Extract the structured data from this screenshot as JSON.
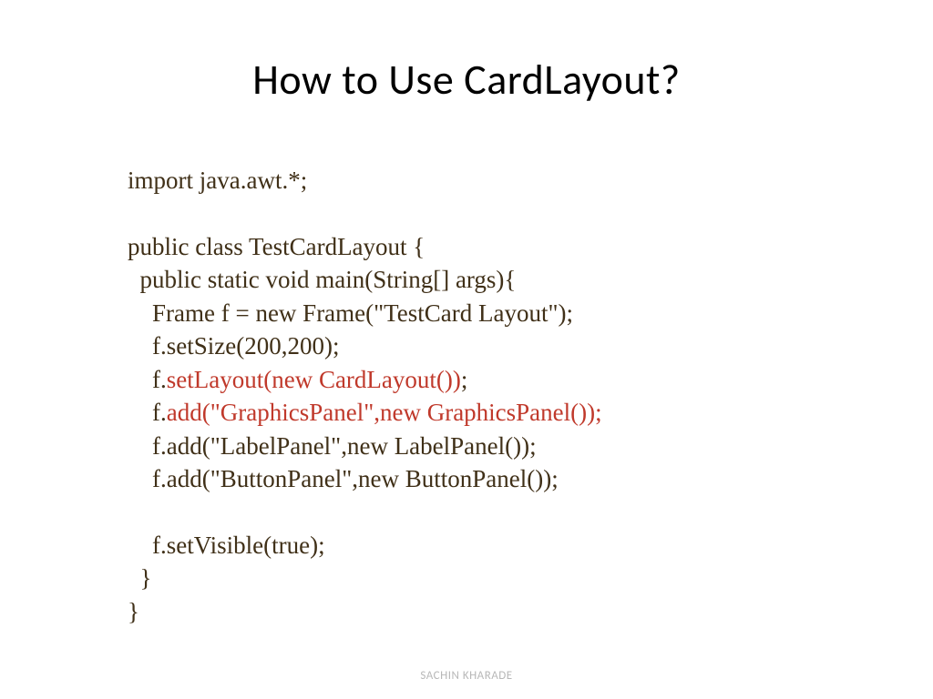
{
  "title": "How to Use CardLayout?",
  "code": {
    "line1": "import java.awt.*;",
    "line2": "",
    "line3": "public class TestCardLayout {",
    "line4": "  public static void main(String[] args){",
    "line5": "    Frame f = new Frame(\"TestCard Layout\");",
    "line6": "    f.setSize(200,200);",
    "line7a": "    f.",
    "line7b": "setLayout(new CardLayout())",
    "line7c": ";",
    "line8a": "    f.",
    "line8b": "add(\"GraphicsPanel\",new GraphicsPanel());",
    "line9": "    f.add(\"LabelPanel\",new LabelPanel());",
    "line10": "    f.add(\"ButtonPanel\",new ButtonPanel());",
    "line11": "",
    "line12": "    f.setVisible(true);",
    "line13": "  }",
    "line14": "}"
  },
  "footer": "SACHIN KHARADE"
}
